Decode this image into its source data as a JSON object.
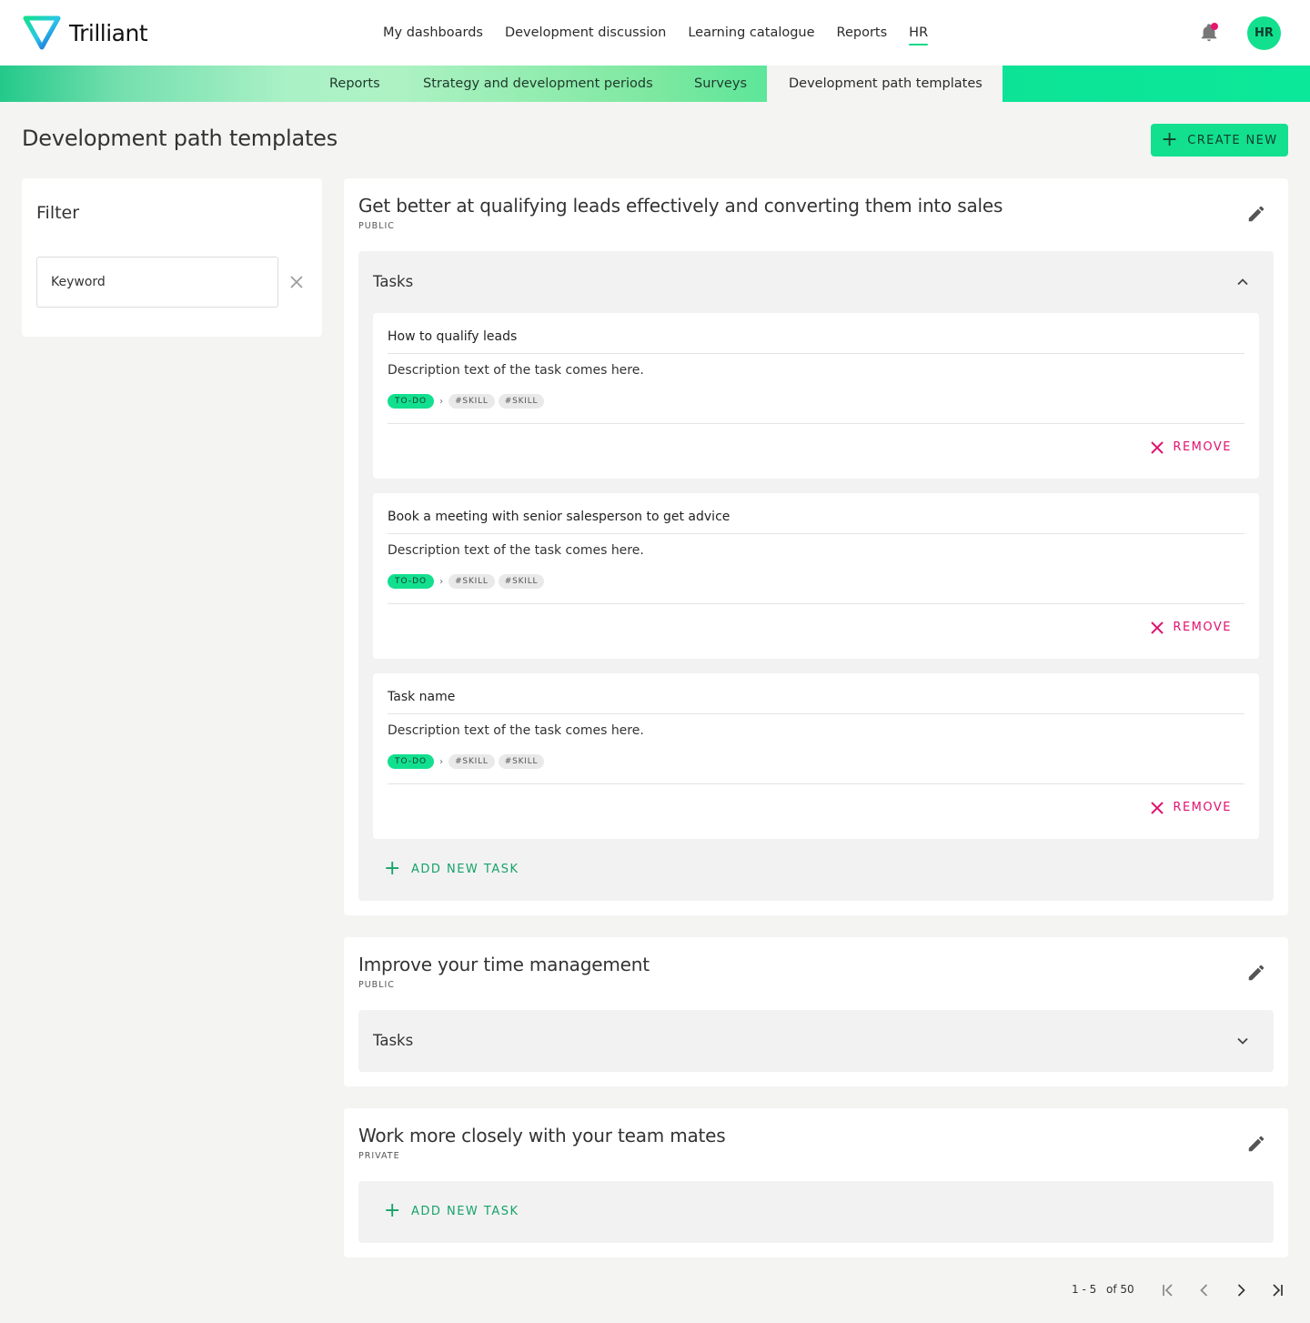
{
  "brand": {
    "name": "Trilliant",
    "accent": "#12e08f",
    "danger": "#e0126f"
  },
  "main_nav": [
    {
      "label": "My dashboards",
      "active": false
    },
    {
      "label": "Development discussion",
      "active": false
    },
    {
      "label": "Learning catalogue",
      "active": false
    },
    {
      "label": "Reports",
      "active": false
    },
    {
      "label": "HR",
      "active": true
    }
  ],
  "user": {
    "initials": "HR",
    "notification_icon": "bell-icon"
  },
  "sub_nav": [
    {
      "label": "Reports",
      "active": false
    },
    {
      "label": "Strategy and development periods",
      "active": false
    },
    {
      "label": "Surveys",
      "active": false
    },
    {
      "label": "Development path templates",
      "active": true
    }
  ],
  "page": {
    "title": "Development path templates",
    "create_label": "CREATE NEW"
  },
  "filter": {
    "title": "Filter",
    "keyword_placeholder": "Keyword",
    "keyword_value": ""
  },
  "templates": [
    {
      "title": "Get better at qualifying leads effectively and converting them into sales",
      "visibility": "PUBLIC",
      "tasks_label": "Tasks",
      "expanded": true,
      "tasks": [
        {
          "name": "How to qualify leads",
          "description": "Description text of the task comes here.",
          "status": "TO-DO",
          "tags": [
            "#SKILL",
            "#SKILL"
          ],
          "remove_label": "REMOVE"
        },
        {
          "name": "Book a meeting with senior salesperson to get advice",
          "description": "Description text of the task comes here.",
          "status": "TO-DO",
          "tags": [
            "#SKILL",
            "#SKILL"
          ],
          "remove_label": "REMOVE"
        },
        {
          "name": "Task name",
          "description": "Description text of the task comes here.",
          "status": "TO-DO",
          "tags": [
            "#SKILL",
            "#SKILL"
          ],
          "remove_label": "REMOVE"
        }
      ],
      "add_task_label": "ADD NEW TASK"
    },
    {
      "title": "Improve your time management",
      "visibility": "PUBLIC",
      "tasks_label": "Tasks",
      "expanded": false
    },
    {
      "title": "Work more closely with your team mates",
      "visibility": "PRIVATE",
      "add_task_label": "ADD NEW TASK"
    }
  ],
  "pagination": {
    "range": "1 - 5",
    "total": "of 50"
  }
}
